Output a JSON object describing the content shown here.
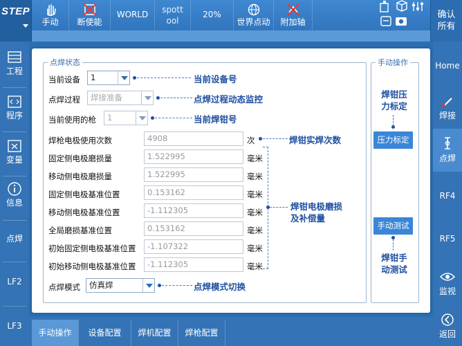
{
  "topbar": {
    "logo": "STEP",
    "items": [
      {
        "label": "手动",
        "icon": "hand-icon"
      },
      {
        "label": "断使能",
        "icon": "disable-icon"
      },
      {
        "label": "WORLD"
      },
      {
        "label_line1": "spott",
        "label_line2": "ool"
      },
      {
        "label": "20%"
      },
      {
        "label": "世界点动",
        "icon": "globe-icon"
      },
      {
        "label": "附加轴",
        "icon": "axis-off-icon"
      }
    ],
    "confirm_line1": "确认",
    "confirm_line2": "所有"
  },
  "left_sidebar": [
    {
      "label": "工程",
      "icon": "project-icon"
    },
    {
      "label": "程序",
      "icon": "program-icon"
    },
    {
      "label": "变量",
      "icon": "variable-icon"
    },
    {
      "label": "信息",
      "icon": "info-icon"
    },
    {
      "label": "点焊"
    },
    {
      "label": "LF2"
    },
    {
      "label": "LF3"
    }
  ],
  "right_sidebar": [
    {
      "label": "Home"
    },
    {
      "label": "焊接",
      "icon": "welding-icon"
    },
    {
      "label": "点焊",
      "icon": "spot-weld-icon",
      "active": true
    },
    {
      "label": "RF4"
    },
    {
      "label": "RF5"
    },
    {
      "label": "监视",
      "icon": "eye-icon"
    },
    {
      "label": "返回",
      "icon": "back-icon"
    }
  ],
  "status_panel": {
    "legend": "点焊状态",
    "device_label": "当前设备",
    "device_value": "1",
    "process_label": "点焊过程",
    "process_value": "焊接准备",
    "gun_label": "当前使用的枪",
    "gun_value": "1",
    "rows": [
      {
        "label": "焊枪电极使用次数",
        "value": "4908",
        "unit": "次"
      },
      {
        "label": "固定侧电极磨损量",
        "value": "1.522995",
        "unit": "毫米"
      },
      {
        "label": "移动侧电极磨损量",
        "value": "1.522995",
        "unit": "毫米"
      },
      {
        "label": "固定侧电极基准位置",
        "value": "0.153162",
        "unit": "毫米"
      },
      {
        "label": "移动侧电极基准位置",
        "value": "-1.112305",
        "unit": "毫米"
      },
      {
        "label": "全局磨损基准位置",
        "value": "0.153162",
        "unit": "毫米"
      },
      {
        "label": "初始固定侧电极基准位置",
        "value": "-1.107322",
        "unit": "毫米"
      },
      {
        "label": "初始移动侧电极基准位置",
        "value": "-1.112305",
        "unit": "毫米"
      }
    ],
    "mode_label": "点焊模式",
    "mode_value": "仿真焊"
  },
  "annotations": {
    "device": "当前设备号",
    "process": "点焊过程动态监控",
    "gun": "当前焊钳号",
    "count": "焊钳实焊次数",
    "wear_line1": "焊钳电极磨损",
    "wear_line2": "及补偿量",
    "mode": "点焊模式切换",
    "pressure_line1": "焊钳压",
    "pressure_line2": "力标定",
    "manual_line1": "焊钳手",
    "manual_line2": "动测试"
  },
  "manual_panel": {
    "legend": "手动操作",
    "pressure_button": "压力标定",
    "manual_test_button": "手动测试"
  },
  "bottom_tabs": [
    {
      "label": "手动操作",
      "active": true
    },
    {
      "label": "设备配置"
    },
    {
      "label": "焊机配置"
    },
    {
      "label": "焊枪配置"
    }
  ]
}
